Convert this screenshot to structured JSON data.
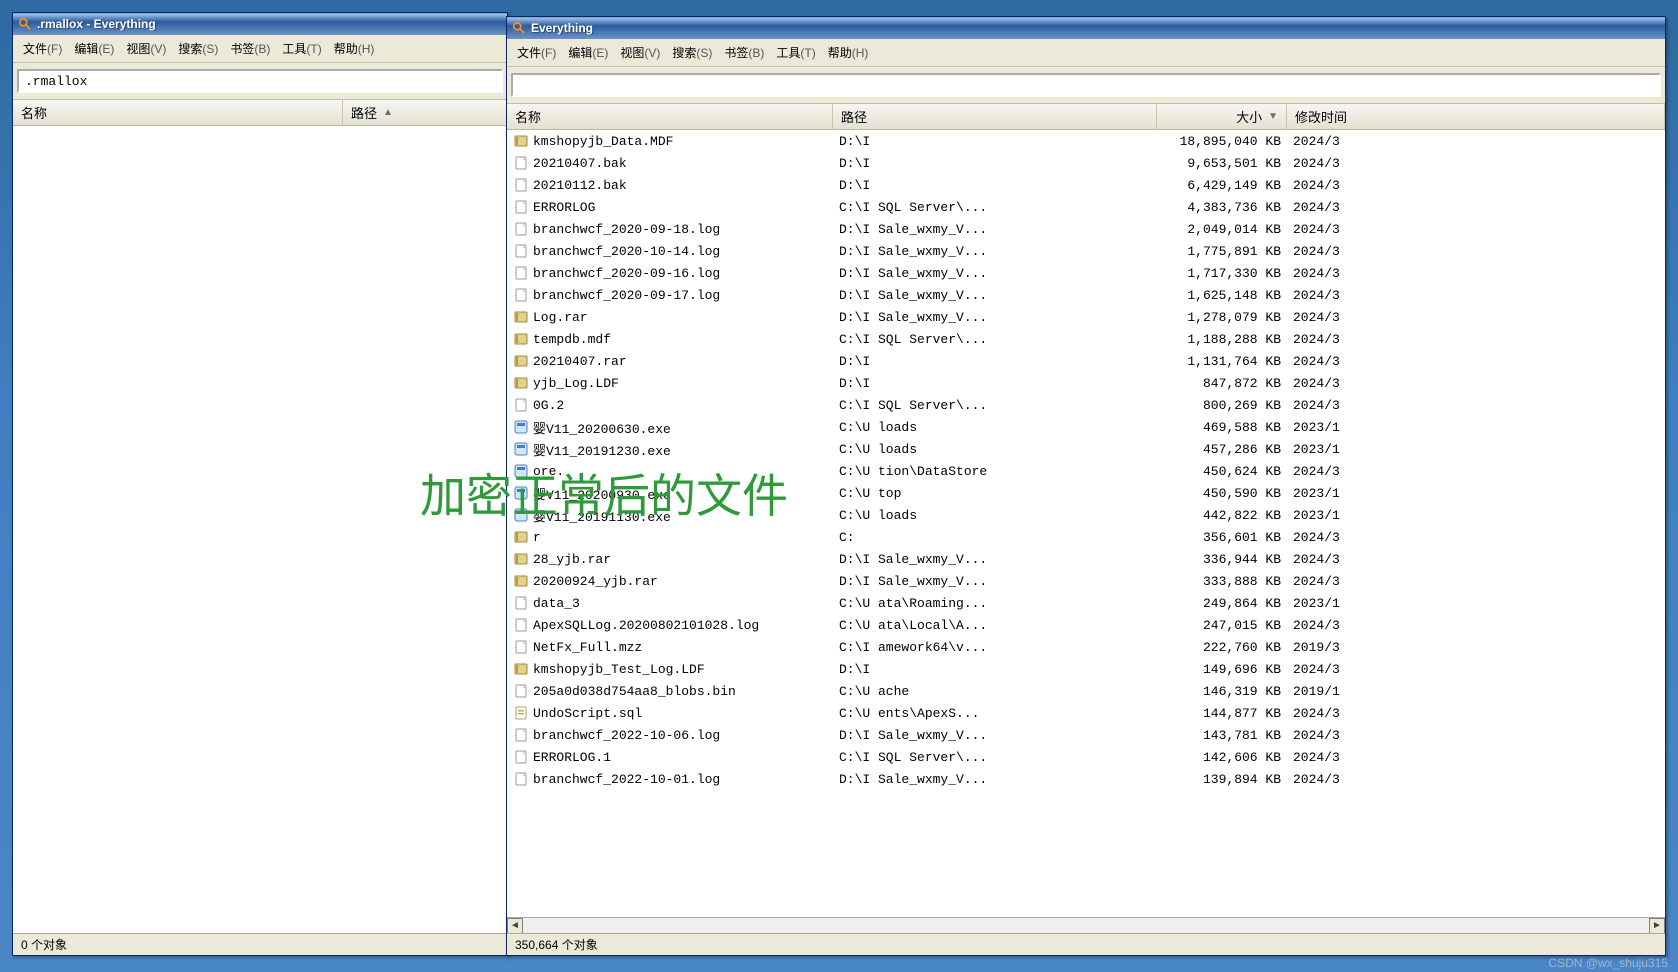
{
  "overlay_text": "加密正常后的文件",
  "watermark": "CSDN @wx_shuju315",
  "window_left": {
    "title": ".rmallox  - Everything",
    "search_value": ".rmallox",
    "menus": [
      {
        "label": "文件",
        "suffix": "(F)"
      },
      {
        "label": "编辑",
        "suffix": "(E)"
      },
      {
        "label": "视图",
        "suffix": "(V)"
      },
      {
        "label": "搜索",
        "suffix": "(S)"
      },
      {
        "label": "书签",
        "suffix": "(B)"
      },
      {
        "label": "工具",
        "suffix": "(T)"
      },
      {
        "label": "帮助",
        "suffix": "(H)"
      }
    ],
    "columns": {
      "name": "名称",
      "path": "路径"
    },
    "status": "0 个对象"
  },
  "window_right": {
    "title": "Everything",
    "search_value": "",
    "menus": [
      {
        "label": "文件",
        "suffix": "(F)"
      },
      {
        "label": "编辑",
        "suffix": "(E)"
      },
      {
        "label": "视图",
        "suffix": "(V)"
      },
      {
        "label": "搜索",
        "suffix": "(S)"
      },
      {
        "label": "书签",
        "suffix": "(B)"
      },
      {
        "label": "工具",
        "suffix": "(T)"
      },
      {
        "label": "帮助",
        "suffix": "(H)"
      }
    ],
    "columns": {
      "name": "名称",
      "path": "路径",
      "size": "大小",
      "date": "修改时间"
    },
    "status": "350,664 个对象",
    "rows": [
      {
        "icon": "archive",
        "name": "kmshopyjb_Data.MDF",
        "path": "D:\\I",
        "size": "18,895,040 KB",
        "date": "2024/3"
      },
      {
        "icon": "file",
        "name": "20210407.bak",
        "path": "D:\\I",
        "size": "9,653,501 KB",
        "date": "2024/3"
      },
      {
        "icon": "file",
        "name": "20210112.bak",
        "path": "D:\\I",
        "size": "6,429,149 KB",
        "date": "2024/3"
      },
      {
        "icon": "file",
        "name": "ERRORLOG",
        "path": "C:\\I            SQL Server\\...",
        "size": "4,383,736 KB",
        "date": "2024/3"
      },
      {
        "icon": "file",
        "name": "branchwcf_2020-09-18.log",
        "path": "D:\\I            Sale_wxmy_V...",
        "size": "2,049,014 KB",
        "date": "2024/3"
      },
      {
        "icon": "file",
        "name": "branchwcf_2020-10-14.log",
        "path": "D:\\I            Sale_wxmy_V...",
        "size": "1,775,891 KB",
        "date": "2024/3"
      },
      {
        "icon": "file",
        "name": "branchwcf_2020-09-16.log",
        "path": "D:\\I            Sale_wxmy_V...",
        "size": "1,717,330 KB",
        "date": "2024/3"
      },
      {
        "icon": "file",
        "name": "branchwcf_2020-09-17.log",
        "path": "D:\\I            Sale_wxmy_V...",
        "size": "1,625,148 KB",
        "date": "2024/3"
      },
      {
        "icon": "archive",
        "name": "Log.rar",
        "path": "D:\\I            Sale_wxmy_V...",
        "size": "1,278,079 KB",
        "date": "2024/3"
      },
      {
        "icon": "archive",
        "name": "tempdb.mdf",
        "path": "C:\\I            SQL Server\\...",
        "size": "1,188,288 KB",
        "date": "2024/3"
      },
      {
        "icon": "archive",
        "name": "20210407.rar",
        "path": "D:\\I",
        "size": "1,131,764 KB",
        "date": "2024/3"
      },
      {
        "icon": "archive",
        "name": "      yjb_Log.LDF",
        "path": "D:\\I",
        "size": "847,872 KB",
        "date": "2024/3"
      },
      {
        "icon": "file",
        "name": "      0G.2",
        "path": "C:\\I            SQL Server\\...",
        "size": "800,269 KB",
        "date": "2024/3"
      },
      {
        "icon": "exe",
        "name": "      婴V11_20200630.exe",
        "path": "C:\\U            loads",
        "size": "469,588 KB",
        "date": "2023/1"
      },
      {
        "icon": "exe",
        "name": "      婴V11_20191230.exe",
        "path": "C:\\U            loads",
        "size": "457,286 KB",
        "date": "2023/1"
      },
      {
        "icon": "exe",
        "name": "      ore.      ",
        "path": "C:\\U            tion\\DataStore",
        "size": "450,624 KB",
        "date": "2024/3"
      },
      {
        "icon": "exe",
        "name": "      婴V11_20200930.exe",
        "path": "C:\\U            top",
        "size": "450,590 KB",
        "date": "2023/1"
      },
      {
        "icon": "exe",
        "name": "      婴V11_20191130.exe",
        "path": "C:\\U            loads",
        "size": "442,822 KB",
        "date": "2023/1"
      },
      {
        "icon": "archive",
        "name": "      r",
        "path": "C:",
        "size": "356,601 KB",
        "date": "2024/3"
      },
      {
        "icon": "archive",
        "name": "      28_yjb.rar",
        "path": "D:\\I            Sale_wxmy_V...",
        "size": "336,944 KB",
        "date": "2024/3"
      },
      {
        "icon": "archive",
        "name": "20200924_yjb.rar",
        "path": "D:\\I            Sale_wxmy_V...",
        "size": "333,888 KB",
        "date": "2024/3"
      },
      {
        "icon": "file",
        "name": "data_3",
        "path": "C:\\U            ata\\Roaming...",
        "size": "249,864 KB",
        "date": "2023/1"
      },
      {
        "icon": "file",
        "name": "ApexSQLLog.20200802101028.log",
        "path": "C:\\U            ata\\Local\\A...",
        "size": "247,015 KB",
        "date": "2024/3"
      },
      {
        "icon": "file",
        "name": "NetFx_Full.mzz",
        "path": "C:\\I            amework64\\v...",
        "size": "222,760 KB",
        "date": "2019/3"
      },
      {
        "icon": "archive",
        "name": "kmshopyjb_Test_Log.LDF",
        "path": "D:\\I",
        "size": "149,696 KB",
        "date": "2024/3"
      },
      {
        "icon": "file",
        "name": "205a0d038d754aa8_blobs.bin",
        "path": "C:\\U            ache",
        "size": "146,319 KB",
        "date": "2019/1"
      },
      {
        "icon": "sql",
        "name": "UndoScript.sql",
        "path": "C:\\U            ents\\ApexS...",
        "size": "144,877 KB",
        "date": "2024/3"
      },
      {
        "icon": "file",
        "name": "branchwcf_2022-10-06.log",
        "path": "D:\\I            Sale_wxmy_V...",
        "size": "143,781 KB",
        "date": "2024/3"
      },
      {
        "icon": "file",
        "name": "ERRORLOG.1",
        "path": "C:\\I            SQL Server\\...",
        "size": "142,606 KB",
        "date": "2024/3"
      },
      {
        "icon": "file",
        "name": "branchwcf_2022-10-01.log",
        "path": "D:\\I            Sale_wxmy_V...",
        "size": "139,894 KB",
        "date": "2024/3"
      }
    ]
  },
  "icons": {
    "magnifier_svg": "magnifier",
    "file": "file",
    "archive": "archive",
    "exe": "exe",
    "sql": "sql"
  }
}
